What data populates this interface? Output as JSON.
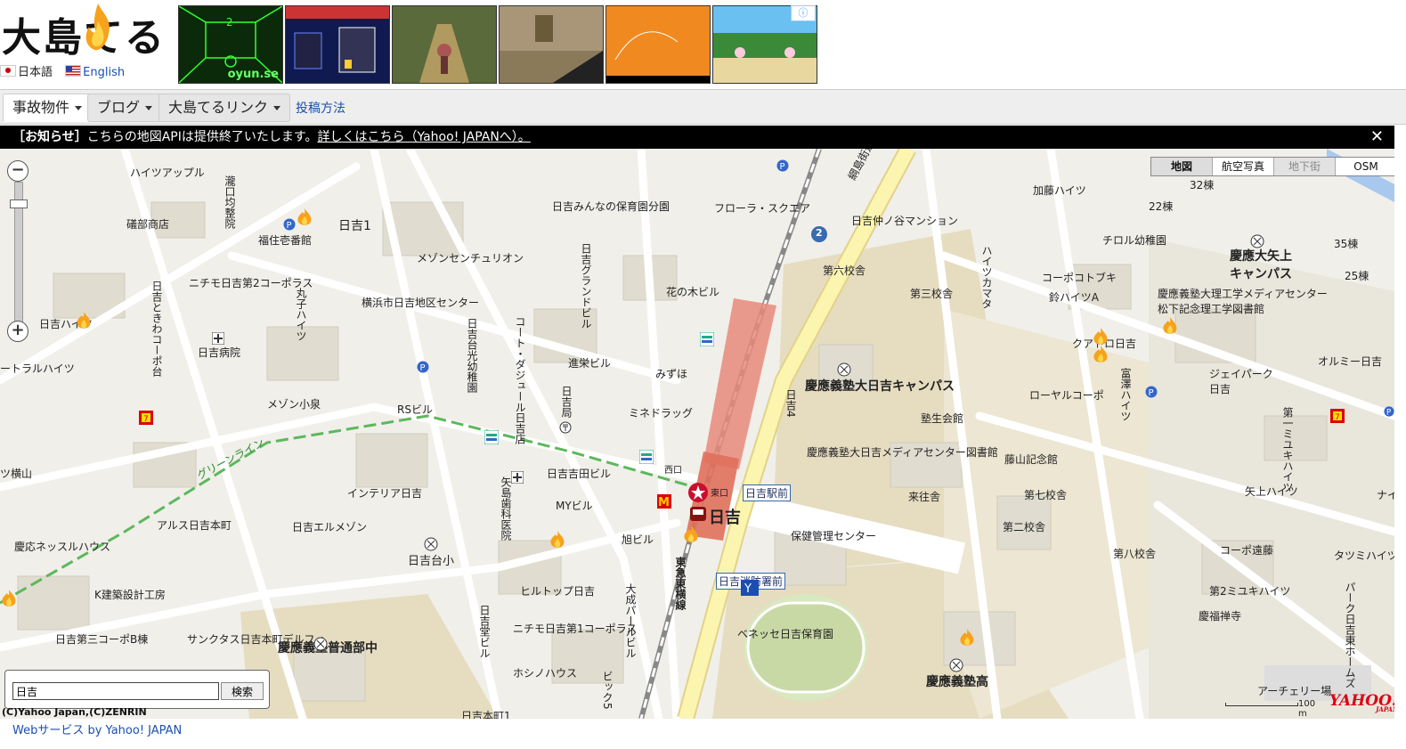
{
  "site": {
    "logo_text": "大島てる",
    "languages": [
      {
        "label": "日本語",
        "flag": "jp"
      },
      {
        "label": "English",
        "flag": "us"
      }
    ],
    "ads": [
      {
        "caption": "oyun.se",
        "color": "#0a2a0a"
      },
      {
        "caption": "",
        "color": "#101a50"
      },
      {
        "caption": "",
        "color": "#5a6a3a"
      },
      {
        "caption": "",
        "color": "#8a7a5a"
      },
      {
        "caption": "",
        "color": "#f08a20"
      },
      {
        "caption": "",
        "color": "#6ac0f0"
      }
    ],
    "ad_choice_icon": "adchoices-icon"
  },
  "nav": {
    "tabs": [
      {
        "label": "事故物件",
        "active": true
      },
      {
        "label": "ブログ",
        "active": false
      },
      {
        "label": "大島てるリンク",
        "active": false
      }
    ],
    "link": "投稿方法"
  },
  "notice": {
    "label": "［お知らせ］",
    "text": "こちらの地図APIは提供終了いたします。",
    "link": "詳しくはこちら（Yahoo! JAPANへ）。",
    "close": "✕"
  },
  "map": {
    "type_buttons": [
      {
        "label": "地図",
        "state": "active"
      },
      {
        "label": "航空写真",
        "state": "normal"
      },
      {
        "label": "地下街",
        "state": "disabled"
      },
      {
        "label": "OSM",
        "state": "normal"
      }
    ],
    "zoom_in": "+",
    "zoom_out": "−",
    "zoom_level_fraction": 0.88,
    "labels": [
      "ハイツアップル",
      "瀧口均整院",
      "礒部商店",
      "福住壱番館",
      "日吉1",
      "ニチモ日吉第2コーポラス",
      "日吉ときわコーポ台",
      "日吉ハイツ",
      "丸子ハイツ",
      "横浜市日吉地区センター",
      "日吉病院",
      "ートラルハイツ",
      "メゾン小泉",
      "RSビル",
      "ツ横山",
      "メゾンセンチュリオン",
      "日吉みんなの保育園分園",
      "フローラ・スクエア",
      "日吉グランドビル",
      "花の木ビル",
      "日吉台光幼稚園",
      "コート・ダジュール日吉店",
      "日吉局",
      "進栄ビル",
      "みずほ",
      "ミネドラッグ",
      "日吉吉田ビル",
      "西口",
      "東口",
      "日吉駅前",
      "日吉",
      "インテリア日吉",
      "矢島歯科医院",
      "MYビル",
      "旭ビル",
      "アルス日吉本町",
      "日吉エルメゾン",
      "慶応ネッスルハウス",
      "日吉台小",
      "K建築設計工房",
      "ヒルトップ日吉",
      "ニチモ日吉第1コーポラス",
      "日吉堂ビル",
      "大成パールビル",
      "東急東横線",
      "日吉消防署前",
      "日吉第三コーポB棟",
      "サンクタス日吉本町デルフィ",
      "慶應義塾普通部中",
      "ホシノハウス",
      "ビック5",
      "日吉本町1",
      "ベネッセ日吉保育園",
      "保健管理センター",
      "慶應義塾高",
      "綱島街道",
      "日吉仲ノ谷マンション",
      "第六校舎",
      "第三校舎",
      "ハイツカマタ",
      "慶應義塾大日吉キャンパス",
      "日吉4",
      "塾生会館",
      "慶應義塾大日吉メディアセンター図書館",
      "来往舎",
      "藤山記念館",
      "第七校舎",
      "第二校舎",
      "第八校舎",
      "加藤ハイツ",
      "32棟",
      "22棟",
      "チロル幼稚園",
      "コーポコトブキ",
      "鈴ハイツA",
      "慶應大矢上キャンパス",
      "35棟",
      "25棟",
      "慶應義塾大理工学メディアセンター松下記念理工学図書館",
      "クアトロ日吉",
      "ジェイパーク日吉",
      "オルミー日吉",
      "ローヤルコーポ",
      "富澤ハイツ",
      "第一ミユキハイツ",
      "矢上ハイツ",
      "コーポ遠藤",
      "第2ミユキハイツ",
      "慶福禅寺",
      "アーチェリー場",
      "タツミハイツ",
      "ナイ",
      "パーク日吉東ホームズ",
      "グリーンライン",
      "2"
    ],
    "search": {
      "value": "日吉",
      "button": "検索"
    },
    "copyright": "(C)Yahoo Japan,(C)ZENRIN",
    "scale_label": "100 m",
    "provider_logo": "YAHOO!",
    "provider_sub": "JAPAN"
  },
  "footer": {
    "link": "Webサービス by Yahoo! JAPAN"
  },
  "colors": {
    "accent": "#1a4fb0",
    "notice_bg": "#000000",
    "map_bg": "#f0efea",
    "building": "#e0ddd0",
    "campus": "#e6dcc0",
    "road_major": "#fbf5b0",
    "station": "#e88a7a"
  },
  "icons": [
    "flame-icon",
    "station-marker-icon",
    "school-icon",
    "hospital-icon",
    "post-office-icon",
    "bus-stop-icon",
    "parking-icon",
    "bank-icon",
    "convenience-store-icon",
    "mcdonalds-icon"
  ]
}
